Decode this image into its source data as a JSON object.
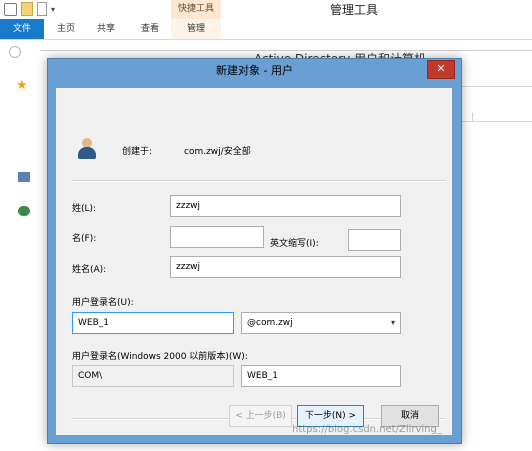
{
  "background_window": {
    "title": "管理工具",
    "tool_tab_header": "快捷工具",
    "tabs": {
      "file": "文件",
      "home": "主页",
      "share": "共享",
      "view": "查看",
      "manage": "管理"
    },
    "ad_window_title": "Active Directory 用户和计算机"
  },
  "dialog": {
    "title": "新建对象 - 用户",
    "close_glyph": "✕",
    "created_in_label": "创建于:",
    "created_in_value": "com.zwj/安全部",
    "last_name_label": "姓(L):",
    "last_name_value": "zzzwj",
    "first_name_label": "名(F):",
    "first_name_value": "",
    "initials_label": "英文缩写(I):",
    "initials_value": "",
    "full_name_label": "姓名(A):",
    "full_name_value": "zzzwj",
    "logon_name_label": "用户登录名(U):",
    "logon_name_value": "WEB_1",
    "domain_select_value": "@com.zwj",
    "pre2000_label": "用户登录名(Windows 2000 以前版本)(W):",
    "pre2000_domain_value": "COM\\",
    "pre2000_name_value": "WEB_1",
    "buttons": {
      "back": "< 上一步(B)",
      "next": "下一步(N) >",
      "cancel": "取消"
    }
  },
  "watermark": "https://blog.csdn.net/Zlirving_",
  "icons": {
    "user": "user-icon",
    "close": "close-icon",
    "dropdown": "chevron-down-icon"
  },
  "colors": {
    "dialog_frame": "#6a9fd4",
    "close_button": "#c0392b",
    "file_tab": "#1979ca",
    "focus_border": "#3399ff"
  }
}
